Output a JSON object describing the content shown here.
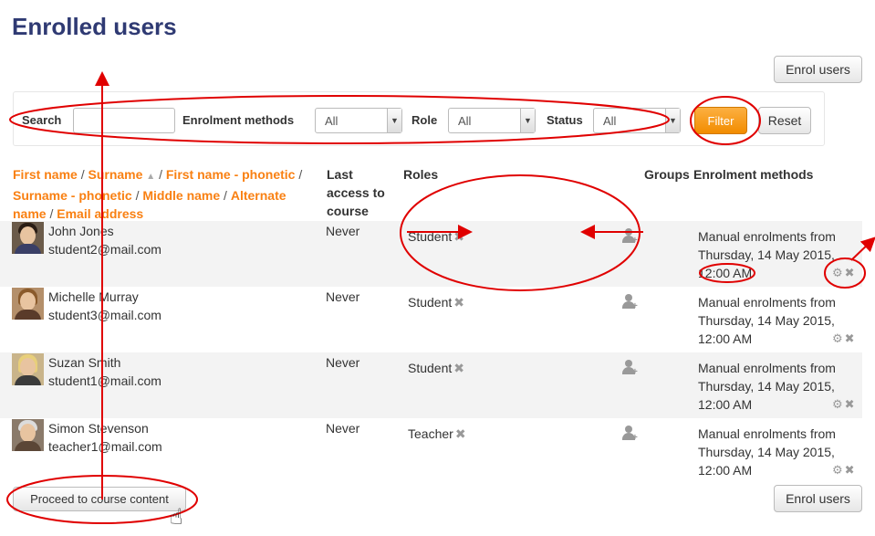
{
  "page": {
    "title": "Enrolled users"
  },
  "toolbar": {
    "enrol_users_label": "Enrol users",
    "proceed_label": "Proceed to course content"
  },
  "filter": {
    "search_label": "Search",
    "search_value": "",
    "methods_label": "Enrolment methods",
    "methods_value": "All",
    "role_label": "Role",
    "role_value": "All",
    "status_label": "Status",
    "status_value": "All",
    "filter_label": "Filter",
    "reset_label": "Reset"
  },
  "table": {
    "sort_links": {
      "first_name": "First name",
      "surname": "Surname",
      "first_name_phonetic": "First name - phonetic",
      "surname_phonetic": "Surname - phonetic",
      "middle_name": "Middle name",
      "alternate_name_1": "Alternate",
      "alternate_name_2": "name",
      "email": "Email address"
    },
    "columns": {
      "last_access": "Last access to course",
      "roles": "Roles",
      "groups": "Groups",
      "enrolment_methods": "Enrolment methods"
    },
    "rows": [
      {
        "name": "John Jones",
        "email": "student2@mail.com",
        "last_access": "Never",
        "role": "Student",
        "method_line1": "Manual enrolments from",
        "method_line2": "Thursday, 14 May 2015,",
        "method_line3": "12:00 AM"
      },
      {
        "name": "Michelle Murray",
        "email": "student3@mail.com",
        "last_access": "Never",
        "role": "Student",
        "method_line1": "Manual enrolments from",
        "method_line2": "Thursday, 14 May 2015,",
        "method_line3": "12:00 AM"
      },
      {
        "name": "Suzan Smith",
        "email": "student1@mail.com",
        "last_access": "Never",
        "role": "Student",
        "method_line1": "Manual enrolments from",
        "method_line2": "Thursday, 14 May 2015,",
        "method_line3": "12:00 AM"
      },
      {
        "name": "Simon Stevenson",
        "email": "teacher1@mail.com",
        "last_access": "Never",
        "role": "Teacher",
        "method_line1": "Manual enrolments from",
        "method_line2": "Thursday, 14 May 2015,",
        "method_line3": "12:00 AM"
      }
    ]
  },
  "colors": {
    "title": "#2f3a73",
    "link": "#f98012",
    "filter_button": "#f28c00",
    "annotation": "#e00000",
    "row_shade": "#f3f3f3"
  },
  "icons": {
    "sort": "sort-ascending-icon",
    "remove": "close-icon",
    "add_group": "add-group-icon",
    "settings": "gear-icon",
    "pointer": "hand-pointer-icon"
  }
}
